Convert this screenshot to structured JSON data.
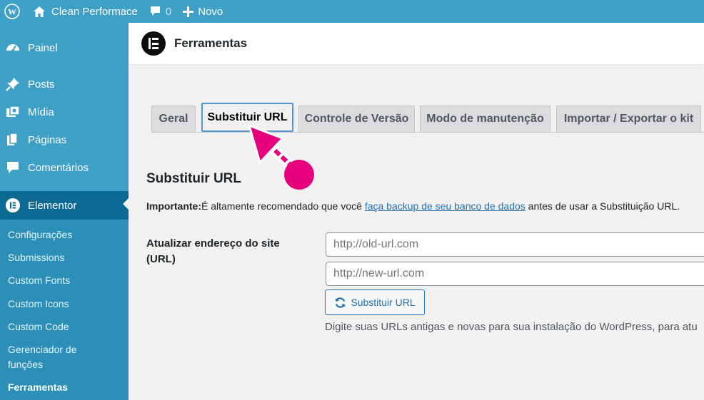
{
  "adminbar": {
    "site_name": "Clean Performace",
    "comments_count": "0",
    "new_label": "Novo"
  },
  "sidebar": {
    "items": [
      {
        "label": "Painel",
        "icon": "dashboard-icon"
      },
      {
        "label": "Posts",
        "icon": "pin-icon"
      },
      {
        "label": "Mídia",
        "icon": "media-icon"
      },
      {
        "label": "Páginas",
        "icon": "pages-icon"
      },
      {
        "label": "Comentários",
        "icon": "comment-icon"
      },
      {
        "label": "Elementor",
        "icon": "elementor-icon"
      }
    ],
    "submenu": [
      "Configurações",
      "Submissions",
      "Custom Fonts",
      "Custom Icons",
      "Custom Code",
      "Gerenciador de funções",
      "Ferramentas"
    ]
  },
  "header": {
    "title": "Ferramentas"
  },
  "tabs": [
    "Geral",
    "Substituir URL",
    "Controle de Versão",
    "Modo de manutenção",
    "Importar / Exportar o kit"
  ],
  "content": {
    "section_title": "Substituir URL",
    "notice_bold": "Importante:",
    "notice_pre": "É altamente recomendado que você ",
    "notice_link": "faça backup de seu banco de dados",
    "notice_post": " antes de usar a Substituição URL.",
    "field_label": "Atualizar endereço do site (URL)",
    "old_url_placeholder": "http://old-url.com",
    "new_url_placeholder": "http://new-url.com",
    "button_label": "Substituir URL",
    "description": "Digite suas URLs antigas e novas para sua instalação do WordPress, para atu"
  },
  "colors": {
    "admin_blue": "#3ea0c7",
    "current_menu": "#0b6a94",
    "annotation_pink": "#e6007e",
    "link_blue": "#2271b1"
  }
}
